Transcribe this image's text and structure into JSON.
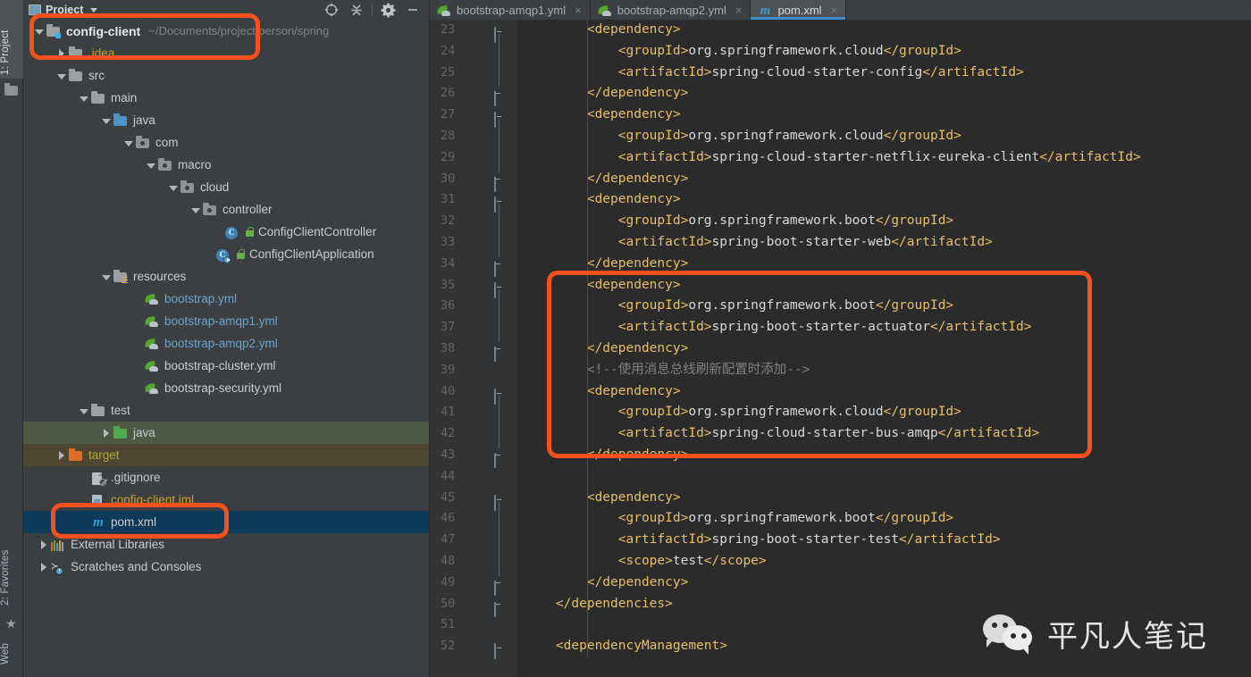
{
  "toolstrip": {
    "tabs": [
      {
        "label": "1: Project",
        "num": "1",
        "rest": ": Project",
        "icon": "folder-icon",
        "active": true
      },
      {
        "label": "2: Favorites",
        "num": "2",
        "rest": ": Favorites",
        "icon": "star-icon",
        "active": false
      },
      {
        "label": "Web",
        "num": "",
        "rest": "Web",
        "icon": "",
        "active": false
      }
    ]
  },
  "project_panel": {
    "title": "Project",
    "tools": [
      {
        "name": "locate-target-icon",
        "glyph": "target"
      },
      {
        "name": "collapse-all-icon",
        "glyph": "collapse"
      },
      {
        "name": "settings-gear-icon",
        "glyph": "gear"
      },
      {
        "name": "hide-panel-icon",
        "glyph": "minus"
      }
    ],
    "tree": [
      {
        "label": "config-client",
        "note": "~/Documents/project/person/spring",
        "indent": 0,
        "arrow": "down",
        "icon": "module-folder",
        "style": "bold"
      },
      {
        "label": ".idea",
        "note": "",
        "indent": 1,
        "arrow": "right",
        "icon": "folder-grey",
        "style": "yellow"
      },
      {
        "label": "src",
        "note": "",
        "indent": 1,
        "arrow": "down",
        "icon": "folder-grey",
        "style": "plain"
      },
      {
        "label": "main",
        "note": "",
        "indent": 2,
        "arrow": "down",
        "icon": "folder-grey",
        "style": "plain"
      },
      {
        "label": "java",
        "note": "",
        "indent": 3,
        "arrow": "down",
        "icon": "folder-blue",
        "style": "plain"
      },
      {
        "label": "com",
        "note": "",
        "indent": 4,
        "arrow": "down",
        "icon": "package",
        "style": "plain"
      },
      {
        "label": "macro",
        "note": "",
        "indent": 5,
        "arrow": "down",
        "icon": "package",
        "style": "plain"
      },
      {
        "label": "cloud",
        "note": "",
        "indent": 6,
        "arrow": "down",
        "icon": "package",
        "style": "plain"
      },
      {
        "label": "controller",
        "note": "",
        "indent": 7,
        "arrow": "down",
        "icon": "package",
        "style": "plain"
      },
      {
        "label": "ConfigClientController",
        "note": "",
        "indent": 8,
        "arrow": "none",
        "icon": "java-class",
        "style": "plain"
      },
      {
        "label": "ConfigClientApplication",
        "note": "",
        "indent": 7.6,
        "arrow": "none",
        "icon": "java-class-runnable",
        "style": "plain"
      },
      {
        "label": "resources",
        "note": "",
        "indent": 3,
        "arrow": "down",
        "icon": "folder-resources",
        "style": "plain"
      },
      {
        "label": "bootstrap.yml",
        "note": "",
        "indent": 4.4,
        "arrow": "none",
        "icon": "yml-file",
        "style": "blue"
      },
      {
        "label": "bootstrap-amqp1.yml",
        "note": "",
        "indent": 4.4,
        "arrow": "none",
        "icon": "yml-file",
        "style": "blue"
      },
      {
        "label": "bootstrap-amqp2.yml",
        "note": "",
        "indent": 4.4,
        "arrow": "none",
        "icon": "yml-file",
        "style": "blue"
      },
      {
        "label": "bootstrap-cluster.yml",
        "note": "",
        "indent": 4.4,
        "arrow": "none",
        "icon": "yml-file",
        "style": "plain"
      },
      {
        "label": "bootstrap-security.yml",
        "note": "",
        "indent": 4.4,
        "arrow": "none",
        "icon": "yml-file",
        "style": "plain"
      },
      {
        "label": "test",
        "note": "",
        "indent": 2,
        "arrow": "down",
        "icon": "folder-grey",
        "style": "plain"
      },
      {
        "label": "java",
        "note": "",
        "indent": 3,
        "arrow": "right",
        "icon": "folder-green",
        "style": "plain",
        "rowbg": "green"
      },
      {
        "label": "target",
        "note": "",
        "indent": 1,
        "arrow": "right",
        "icon": "folder-orange",
        "style": "olive",
        "rowbg": "excluded"
      },
      {
        "label": ".gitignore",
        "note": "",
        "indent": 2,
        "arrow": "none",
        "icon": "gitignore-file",
        "style": "plain"
      },
      {
        "label": "config-client.iml",
        "note": "",
        "indent": 2,
        "arrow": "none",
        "icon": "iml-file",
        "style": "yellow"
      },
      {
        "label": "pom.xml",
        "note": "",
        "indent": 2,
        "arrow": "none",
        "icon": "maven-file",
        "style": "plain",
        "rowbg": "selected"
      },
      {
        "label": "External Libraries",
        "note": "",
        "indent": 0.2,
        "arrow": "right",
        "icon": "external-libraries",
        "style": "plain"
      },
      {
        "label": "Scratches and Consoles",
        "note": "",
        "indent": 0.2,
        "arrow": "right",
        "icon": "scratches",
        "style": "plain"
      }
    ]
  },
  "editor": {
    "tabs": [
      {
        "label": "bootstrap-amqp1.yml",
        "icon": "yml-file",
        "active": false,
        "close": "×"
      },
      {
        "label": "bootstrap-amqp2.yml",
        "icon": "yml-file",
        "active": false,
        "close": "×"
      },
      {
        "label": "pom.xml",
        "icon": "maven-file",
        "active": true,
        "close": "×"
      }
    ],
    "first_line_number": 23,
    "lines": [
      {
        "n": "23",
        "fold": "open",
        "indent": 8,
        "segs": [
          {
            "t": "tg",
            "v": "<dependency>"
          }
        ]
      },
      {
        "n": "24",
        "fold": "",
        "indent": 12,
        "segs": [
          {
            "t": "tg",
            "v": "<groupId>"
          },
          {
            "t": "tx",
            "v": "org.springframework.cloud"
          },
          {
            "t": "tg",
            "v": "</groupId>"
          }
        ]
      },
      {
        "n": "25",
        "fold": "",
        "indent": 12,
        "segs": [
          {
            "t": "tg",
            "v": "<artifactId>"
          },
          {
            "t": "tx",
            "v": "spring-cloud-starter-config"
          },
          {
            "t": "tg",
            "v": "</artifactId>"
          }
        ]
      },
      {
        "n": "26",
        "fold": "end",
        "indent": 8,
        "segs": [
          {
            "t": "tg",
            "v": "</dependency>"
          }
        ]
      },
      {
        "n": "27",
        "fold": "open",
        "indent": 8,
        "segs": [
          {
            "t": "tg",
            "v": "<dependency>"
          }
        ]
      },
      {
        "n": "28",
        "fold": "",
        "indent": 12,
        "segs": [
          {
            "t": "tg",
            "v": "<groupId>"
          },
          {
            "t": "tx",
            "v": "org.springframework.cloud"
          },
          {
            "t": "tg",
            "v": "</groupId>"
          }
        ]
      },
      {
        "n": "29",
        "fold": "",
        "indent": 12,
        "segs": [
          {
            "t": "tg",
            "v": "<artifactId>"
          },
          {
            "t": "tx",
            "v": "spring-cloud-starter-netflix-eureka-client"
          },
          {
            "t": "tg",
            "v": "</artifactId>"
          }
        ]
      },
      {
        "n": "30",
        "fold": "end",
        "indent": 8,
        "segs": [
          {
            "t": "tg",
            "v": "</dependency>"
          }
        ]
      },
      {
        "n": "31",
        "fold": "open",
        "indent": 8,
        "segs": [
          {
            "t": "tg",
            "v": "<dependency>"
          }
        ]
      },
      {
        "n": "32",
        "fold": "",
        "indent": 12,
        "segs": [
          {
            "t": "tg",
            "v": "<groupId>"
          },
          {
            "t": "tx",
            "v": "org.springframework.boot"
          },
          {
            "t": "tg",
            "v": "</groupId>"
          }
        ]
      },
      {
        "n": "33",
        "fold": "",
        "indent": 12,
        "segs": [
          {
            "t": "tg",
            "v": "<artifactId>"
          },
          {
            "t": "tx",
            "v": "spring-boot-starter-web"
          },
          {
            "t": "tg",
            "v": "</artifactId>"
          }
        ]
      },
      {
        "n": "34",
        "fold": "end",
        "indent": 8,
        "segs": [
          {
            "t": "tg",
            "v": "</dependency>"
          }
        ]
      },
      {
        "n": "35",
        "fold": "open",
        "indent": 8,
        "segs": [
          {
            "t": "tg",
            "v": "<dependency>"
          }
        ]
      },
      {
        "n": "36",
        "fold": "",
        "indent": 12,
        "segs": [
          {
            "t": "tg",
            "v": "<groupId>"
          },
          {
            "t": "tx",
            "v": "org.springframework.boot"
          },
          {
            "t": "tg",
            "v": "</groupId>"
          }
        ]
      },
      {
        "n": "37",
        "fold": "",
        "indent": 12,
        "segs": [
          {
            "t": "tg",
            "v": "<artifactId>"
          },
          {
            "t": "tx",
            "v": "spring-boot-starter-actuator"
          },
          {
            "t": "tg",
            "v": "</artifactId>"
          }
        ]
      },
      {
        "n": "38",
        "fold": "end",
        "indent": 8,
        "segs": [
          {
            "t": "tg",
            "v": "</dependency>"
          }
        ]
      },
      {
        "n": "39",
        "fold": "",
        "indent": 8,
        "segs": [
          {
            "t": "cm",
            "v": "<!--使用消息总线刷新配置时添加-->"
          }
        ]
      },
      {
        "n": "40",
        "fold": "open",
        "indent": 8,
        "segs": [
          {
            "t": "tg",
            "v": "<dependency>"
          }
        ]
      },
      {
        "n": "41",
        "fold": "",
        "indent": 12,
        "segs": [
          {
            "t": "tg",
            "v": "<groupId>"
          },
          {
            "t": "tx",
            "v": "org.springframework.cloud"
          },
          {
            "t": "tg",
            "v": "</groupId>"
          }
        ]
      },
      {
        "n": "42",
        "fold": "",
        "indent": 12,
        "segs": [
          {
            "t": "tg",
            "v": "<artifactId>"
          },
          {
            "t": "tx",
            "v": "spring-cloud-starter-bus-amqp"
          },
          {
            "t": "tg",
            "v": "</artifactId>"
          }
        ]
      },
      {
        "n": "43",
        "fold": "end",
        "indent": 8,
        "segs": [
          {
            "t": "tg",
            "v": "</dependency>"
          }
        ]
      },
      {
        "n": "44",
        "fold": "",
        "indent": 0,
        "segs": [
          {
            "t": "tx",
            "v": ""
          }
        ]
      },
      {
        "n": "45",
        "fold": "open",
        "indent": 8,
        "segs": [
          {
            "t": "tg",
            "v": "<dependency>"
          }
        ]
      },
      {
        "n": "46",
        "fold": "",
        "indent": 12,
        "segs": [
          {
            "t": "tg",
            "v": "<groupId>"
          },
          {
            "t": "tx",
            "v": "org.springframework.boot"
          },
          {
            "t": "tg",
            "v": "</groupId>"
          }
        ]
      },
      {
        "n": "47",
        "fold": "",
        "indent": 12,
        "segs": [
          {
            "t": "tg",
            "v": "<artifactId>"
          },
          {
            "t": "tx",
            "v": "spring-boot-starter-test"
          },
          {
            "t": "tg",
            "v": "</artifactId>"
          }
        ]
      },
      {
        "n": "48",
        "fold": "",
        "indent": 12,
        "segs": [
          {
            "t": "tg",
            "v": "<scope>"
          },
          {
            "t": "tx",
            "v": "test"
          },
          {
            "t": "tg",
            "v": "</scope>"
          }
        ]
      },
      {
        "n": "49",
        "fold": "end",
        "indent": 8,
        "segs": [
          {
            "t": "tg",
            "v": "</dependency>"
          }
        ]
      },
      {
        "n": "50",
        "fold": "end",
        "indent": 4,
        "segs": [
          {
            "t": "tg",
            "v": "</dependencies>"
          }
        ]
      },
      {
        "n": "51",
        "fold": "",
        "indent": 0,
        "segs": [
          {
            "t": "tx",
            "v": ""
          }
        ]
      },
      {
        "n": "52",
        "fold": "open",
        "indent": 4,
        "segs": [
          {
            "t": "tg",
            "v": "<dependencyManagement>"
          }
        ]
      }
    ]
  },
  "annotations": [
    {
      "name": "project-root-highlight",
      "color": "#f4511e"
    },
    {
      "name": "pom-xml-highlight",
      "color": "#f4511e"
    },
    {
      "name": "bus-amqp-dependency-highlight",
      "color": "#f4511e"
    }
  ],
  "watermark": {
    "text": "平凡人笔记",
    "icon": "wechat-icon"
  },
  "colors": {
    "accent_orange": "#f4511e",
    "panel_bg": "#3c3f41",
    "editor_bg": "#2b2b2b",
    "gutter_bg": "#313335",
    "tag": "#e8bf6a",
    "text": "#d6d9dc",
    "comment": "#808080",
    "selection_blue": "#0d3a58",
    "test_source_green": "#4d5942",
    "excluded_brown": "#4f4632"
  }
}
